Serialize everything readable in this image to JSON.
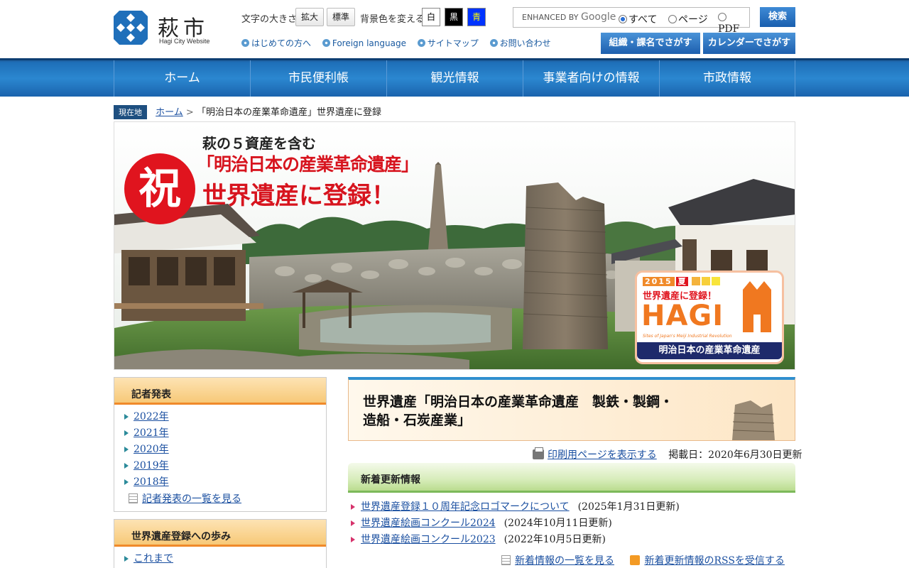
{
  "header": {
    "logo_name": "萩市",
    "logo_sub": "Hagi City Website",
    "font_size_label": "文字の大きさ",
    "font_enlarge": "拡大",
    "font_standard": "標準",
    "bg_color_label": "背景色を変える",
    "bg_white": "白",
    "bg_black": "黒",
    "bg_blue": "青",
    "sublinks": [
      "はじめての方へ",
      "Foreign language",
      "サイトマップ",
      "お問い合わせ"
    ],
    "search": {
      "enhanced_by": "ENHANCED BY",
      "google": "Google",
      "options": [
        "すべて",
        "ページ",
        "PDF"
      ],
      "selected": "すべて",
      "button": "検索"
    },
    "org_search_button": "組織・課名でさがす",
    "calendar_search_button": "カレンダーでさがす"
  },
  "nav": [
    "ホーム",
    "市民便利帳",
    "観光情報",
    "事業者向けの情報",
    "市政情報"
  ],
  "breadcrumb": {
    "here_label": "現在地",
    "home": "ホーム",
    "separator": ">",
    "current": "「明治日本の産業革命遺産」世界遺産に登録"
  },
  "hero": {
    "celebrate": "祝",
    "line1": "萩の５資産を含む",
    "line2": "「明治日本の産業革命遺産」",
    "line3": "世界遺産に登録！",
    "badge_year": "2015",
    "badge_season": "夏",
    "badge_reg": "世界遺産に登録！",
    "badge_hagi": "HAGI",
    "badge_en": "Sites of Japan's Meiji Industrial Revolution",
    "badge_jp": "明治日本の産業革命遺産"
  },
  "sidebar": {
    "press": {
      "title": "記者発表",
      "items": [
        "2022年",
        "2021年",
        "2020年",
        "2019年",
        "2018年"
      ],
      "more": "記者発表の一覧を見る"
    },
    "heritage": {
      "title": "世界遺産登録への歩み",
      "items": [
        "これまで"
      ]
    }
  },
  "main": {
    "title": "世界遺産「明治日本の産業革命遺産　製鉄・製鋼・造船・石炭産業」",
    "print_link": "印刷用ページを表示する",
    "posted": "掲載日：2020年6月30日更新",
    "news": {
      "title": "新着更新情報",
      "items": [
        {
          "label": "世界遺産登録１０周年記念ロゴマークについて",
          "date": "(2025年1月31日更新)"
        },
        {
          "label": "世界遺産絵画コンクール2024",
          "date": "(2024年10月11日更新)"
        },
        {
          "label": "世界遺産絵画コンクール2023",
          "date": "(2022年10月5日更新)"
        }
      ],
      "more": "新着情報の一覧を見る",
      "rss": "新着更新情報のRSSを受信する"
    }
  },
  "colors": {
    "nav_blue": "#2b87d0",
    "accent_orange": "#f08a2a",
    "link_blue": "#1a4fa0",
    "celebrate_red": "#e0141e"
  }
}
